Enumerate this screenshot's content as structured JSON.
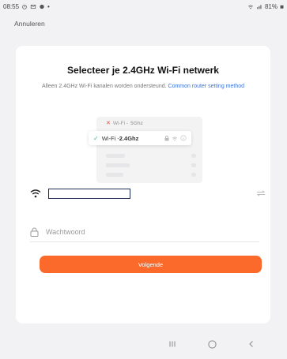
{
  "status": {
    "time": "08:55",
    "battery": "81%",
    "left_icons": [
      "alarm-icon",
      "mail-icon",
      "app-icon"
    ],
    "dot": "•"
  },
  "header": {
    "cancel_label": "Annuleren"
  },
  "card": {
    "title": "Selecteer je 2.4GHz Wi-Fi netwerk",
    "subtitle": "Alleen 2.4GHz Wi-Fi kanalen worden ondersteund.",
    "subtitle_link": "Common router setting method"
  },
  "illustration": {
    "wrong": {
      "mark": "✕",
      "prefix": "Wi-Fi - ",
      "band": "5Ghz"
    },
    "right": {
      "mark": "✓",
      "prefix": "Wi-Fi - ",
      "band": "2.4Ghz"
    }
  },
  "form": {
    "ssid_value": "",
    "password_placeholder": "Wachtwoord",
    "submit_label": "Volgende"
  },
  "colors": {
    "accent": "#fb6a2a",
    "link": "#3a73d8",
    "check": "#3cbf7c",
    "cross": "#e24a3b"
  }
}
